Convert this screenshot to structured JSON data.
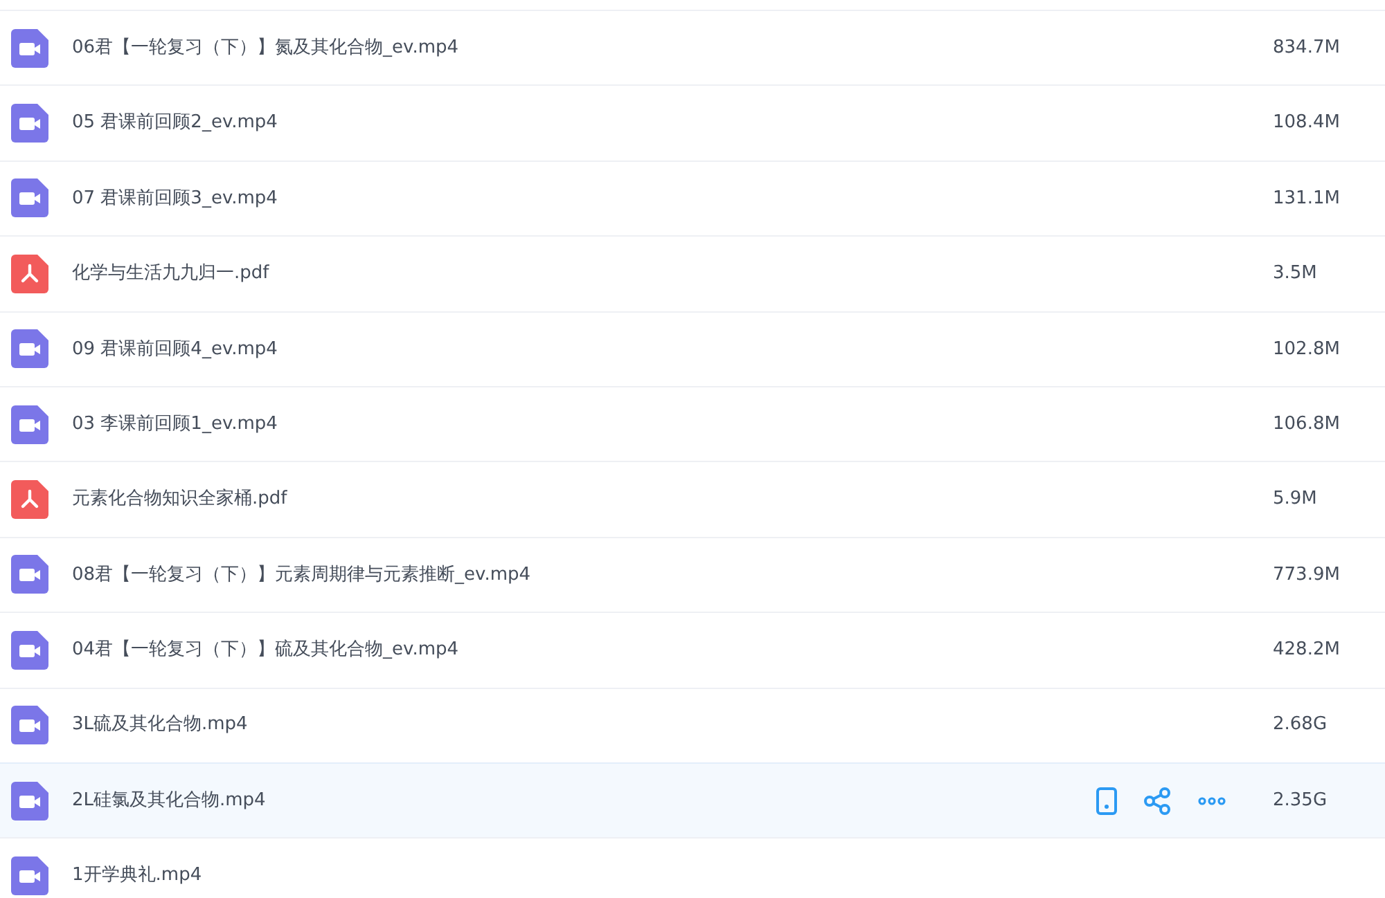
{
  "files": [
    {
      "kind": "video",
      "name": "06君【一轮复习（下）】氮及其化合物_ev.mp4",
      "size": "834.7M",
      "hovered": false
    },
    {
      "kind": "video",
      "name": "05 君课前回顾2_ev.mp4",
      "size": "108.4M",
      "hovered": false
    },
    {
      "kind": "video",
      "name": "07 君课前回顾3_ev.mp4",
      "size": "131.1M",
      "hovered": false
    },
    {
      "kind": "pdf",
      "name": "化学与生活九九归一.pdf",
      "size": "3.5M",
      "hovered": false
    },
    {
      "kind": "video",
      "name": "09 君课前回顾4_ev.mp4",
      "size": "102.8M",
      "hovered": false
    },
    {
      "kind": "video",
      "name": "03 李课前回顾1_ev.mp4",
      "size": "106.8M",
      "hovered": false
    },
    {
      "kind": "pdf",
      "name": "元素化合物知识全家桶.pdf",
      "size": "5.9M",
      "hovered": false
    },
    {
      "kind": "video",
      "name": "08君【一轮复习（下）】元素周期律与元素推断_ev.mp4",
      "size": "773.9M",
      "hovered": false
    },
    {
      "kind": "video",
      "name": "04君【一轮复习（下）】硫及其化合物_ev.mp4",
      "size": "428.2M",
      "hovered": false
    },
    {
      "kind": "video",
      "name": "3L硫及其化合物.mp4",
      "size": "2.68G",
      "hovered": false
    },
    {
      "kind": "video",
      "name": "2L硅氯及其化合物.mp4",
      "size": "2.35G",
      "hovered": true
    },
    {
      "kind": "video",
      "name": "1开学典礼.mp4",
      "hovered": false
    }
  ]
}
